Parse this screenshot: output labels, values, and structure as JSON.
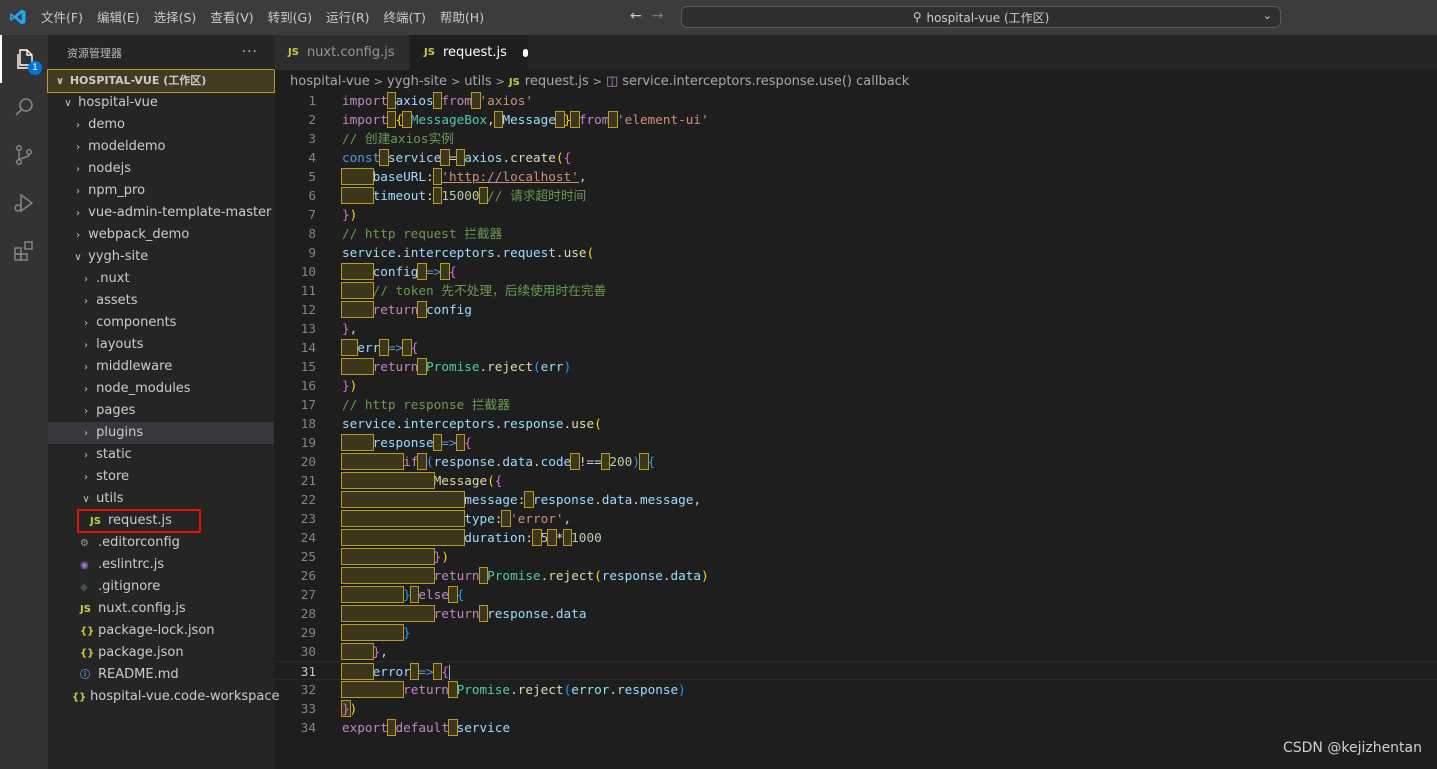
{
  "menu": [
    "文件(F)",
    "编辑(E)",
    "选择(S)",
    "查看(V)",
    "转到(G)",
    "运行(R)",
    "终端(T)",
    "帮助(H)"
  ],
  "search": {
    "text": "hospital-vue (工作区)"
  },
  "explorer": {
    "header": "资源管理器",
    "more": "···",
    "workspace": "HOSPITAL-VUE (工作区)",
    "items": [
      {
        "label": "hospital-vue"
      },
      {
        "label": "demo"
      },
      {
        "label": "modeldemo"
      },
      {
        "label": "nodejs"
      },
      {
        "label": "npm_pro"
      },
      {
        "label": "vue-admin-template-master"
      },
      {
        "label": "webpack_demo"
      },
      {
        "label": "yygh-site"
      },
      {
        "label": ".nuxt"
      },
      {
        "label": "assets"
      },
      {
        "label": "components"
      },
      {
        "label": "layouts"
      },
      {
        "label": "middleware"
      },
      {
        "label": "node_modules"
      },
      {
        "label": "pages"
      },
      {
        "label": "plugins"
      },
      {
        "label": "static"
      },
      {
        "label": "store"
      },
      {
        "label": "utils"
      },
      {
        "label": "request.js"
      },
      {
        "label": ".editorconfig"
      },
      {
        "label": ".eslintrc.js"
      },
      {
        "label": ".gitignore"
      },
      {
        "label": "nuxt.config.js"
      },
      {
        "label": "package-lock.json"
      },
      {
        "label": "package.json"
      },
      {
        "label": "README.md"
      },
      {
        "label": "hospital-vue.code-workspace"
      }
    ]
  },
  "tabs": [
    {
      "label": "nuxt.config.js",
      "icon": "JS"
    },
    {
      "label": "request.js",
      "icon": "JS"
    }
  ],
  "breadcrumb": [
    "hospital-vue",
    "yygh-site",
    "utils",
    "request.js",
    "service.interceptors.response.use() callback"
  ],
  "badge": "1",
  "code": {
    "line_numbers": [
      "1",
      "2",
      "3",
      "4",
      "5",
      "6",
      "7",
      "8",
      "9",
      "10",
      "11",
      "12",
      "13",
      "14",
      "15",
      "16",
      "17",
      "18",
      "19",
      "20",
      "21",
      "22",
      "23",
      "24",
      "25",
      "26",
      "27",
      "28",
      "29",
      "30",
      "31",
      "32",
      "33",
      "34"
    ],
    "current_line": "31",
    "strings": {
      "axios_mod": "'axios'",
      "element_ui": "'element-ui'",
      "comment_create": "// 创建axios实例",
      "base_url": "'http://localhost'",
      "timeout_val": "15000",
      "comment_timeout": "// 请求超时时间",
      "comment_http_request": "// http request 拦截器",
      "comment_token": "// token 先不处理，后续使用时在完善",
      "comment_http_response": "// http response 拦截器",
      "status_200": "200",
      "error_str": "'error'",
      "dur_5": "5",
      "dur_1000": "1000"
    }
  },
  "watermark": "CSDN @kejizhentan"
}
